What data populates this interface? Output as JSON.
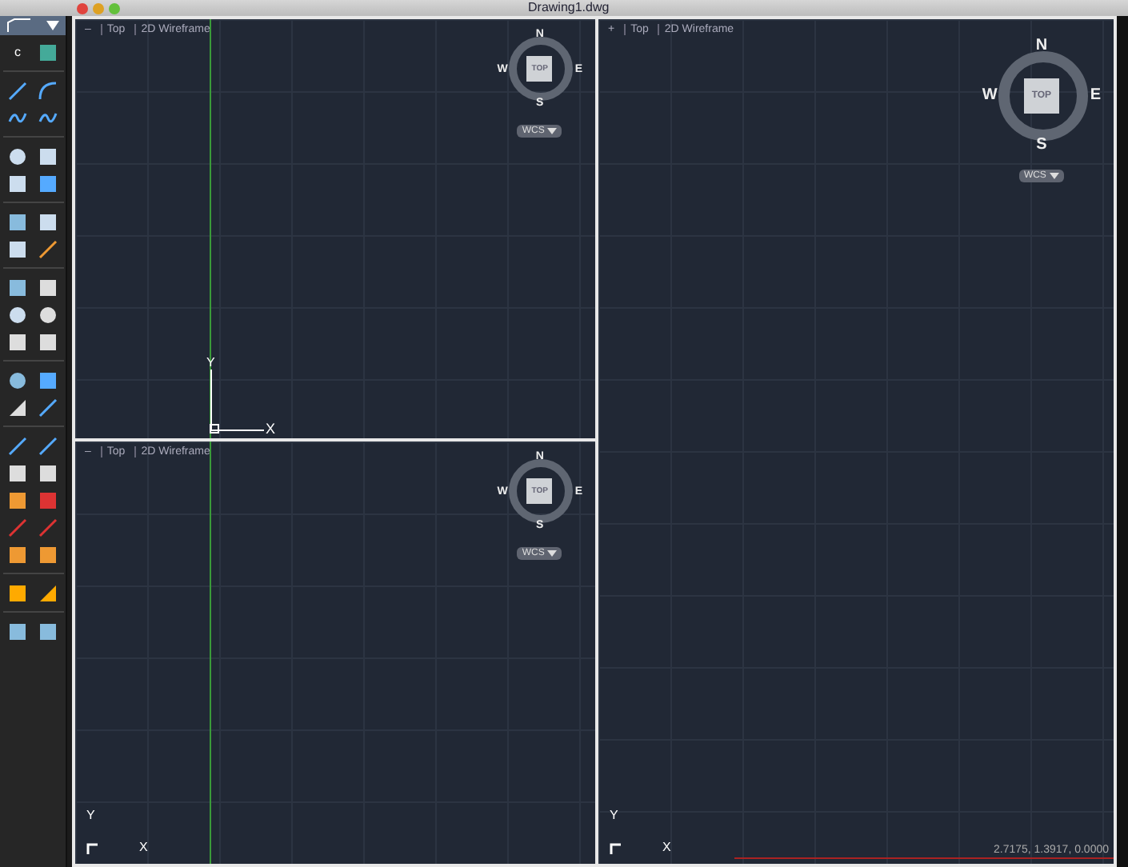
{
  "window": {
    "title": "Drawing1.dwg"
  },
  "toolbar": {
    "label": "c"
  },
  "viewports": [
    {
      "control": "–",
      "view": "Top",
      "style": "2D Wireframe",
      "compass": {
        "n": "N",
        "s": "S",
        "e": "E",
        "w": "W",
        "cube": "TOP"
      },
      "ucs": "WCS",
      "axis_y": "Y",
      "axis_x": "X"
    },
    {
      "control": "–",
      "view": "Top",
      "style": "2D Wireframe",
      "compass": {
        "n": "N",
        "s": "S",
        "e": "E",
        "w": "W",
        "cube": "TOP"
      },
      "ucs": "WCS",
      "axis_y": "Y",
      "axis_x": "X"
    },
    {
      "control": "+",
      "view": "Top",
      "style": "2D Wireframe",
      "compass": {
        "n": "N",
        "s": "S",
        "e": "E",
        "w": "W",
        "cube": "TOP"
      },
      "ucs": "WCS",
      "axis_y": "Y",
      "axis_x": "X",
      "coordinates": "2.7175, 1.3917, 0.0000"
    }
  ]
}
